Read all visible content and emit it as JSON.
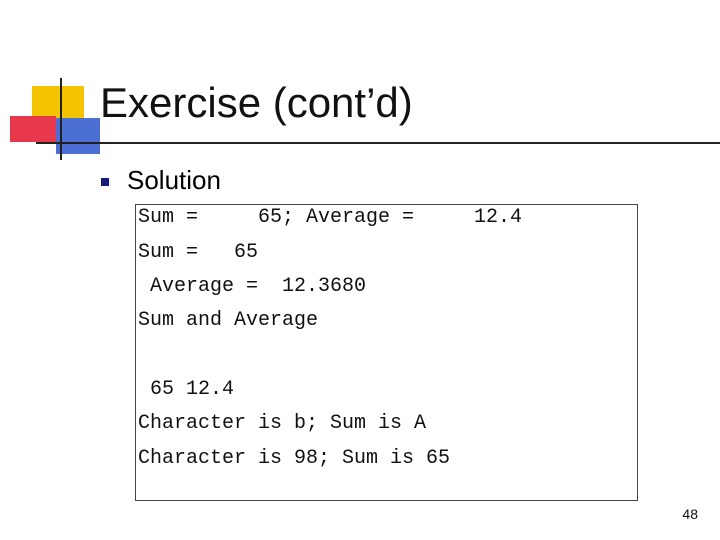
{
  "slide": {
    "title": "Exercise (cont’d)",
    "bullet": "Solution",
    "output_lines": [
      "Sum =     65; Average =     12.4",
      "Sum =   65",
      " Average =  12.3680",
      "Sum and Average",
      "",
      " 65 12.4",
      "Character is b; Sum is A",
      "Character is 98; Sum is 65"
    ],
    "page_number": "48"
  },
  "colors": {
    "accent_yellow": "#f5c400",
    "accent_red": "#e8384b",
    "accent_blue": "#4c6fd6",
    "bullet": "#1a1a7a"
  }
}
